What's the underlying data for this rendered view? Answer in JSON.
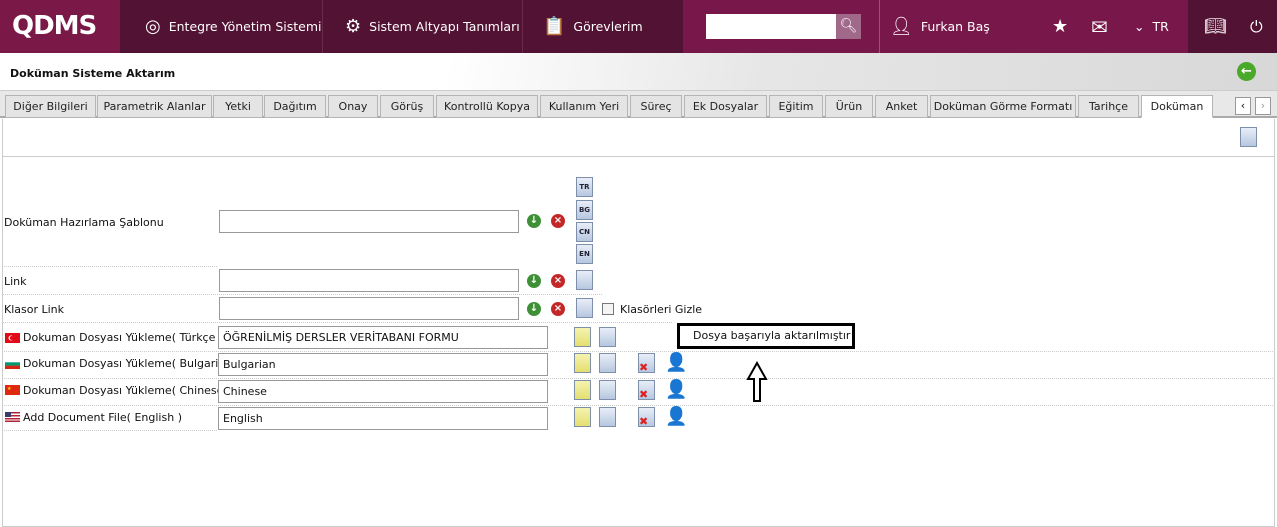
{
  "header": {
    "logo": "QDMS",
    "nav": [
      {
        "label": "Entegre Yönetim Sistemi",
        "icon": "q-circle-icon"
      },
      {
        "label": "Sistem Altyapı Tanımları",
        "icon": "gear-icon"
      },
      {
        "label": "Görevlerim",
        "icon": "clipboard-icon"
      }
    ],
    "search_placeholder": "",
    "user": "Furkan Baş",
    "lang": "TR"
  },
  "page": {
    "title": "Doküman Sisteme Aktarım"
  },
  "tabs": [
    "Diğer Bilgileri",
    "Parametrik Alanlar",
    "Yetki",
    "Dağıtım",
    "Onay",
    "Görüş",
    "Kontrollü Kopya",
    "Kullanım Yeri",
    "Süreç",
    "Ek Dosyalar",
    "Eğitim",
    "Ürün",
    "Anket",
    "Doküman Görme Formatı",
    "Tarihçe",
    "Doküman"
  ],
  "active_tab": "Doküman",
  "form": {
    "template_label": "Doküman Hazırlama Şablonu",
    "template_value": "",
    "lang_icons": [
      "TR",
      "BG",
      "CN",
      "EN"
    ],
    "link_label": "Link",
    "link_value": "",
    "folder_link_label": "Klasor Link",
    "folder_link_value": "",
    "hide_folders_label": "Klasörleri Gizle",
    "uploads": [
      {
        "label": "Dokuman Dosyası Yükleme( Türkçe )",
        "value": "ÖĞRENİLMİŞ DERSLER VERİTABANI FORMU",
        "flag": "tr"
      },
      {
        "label": "Dokuman Dosyası Yükleme( Bulgarian )",
        "value": "Bulgarian",
        "flag": "bg"
      },
      {
        "label": "Dokuman Dosyası Yükleme( Chinese )",
        "value": "Chinese",
        "flag": "cn"
      },
      {
        "label": "Add Document File( English )",
        "value": "English",
        "flag": "us"
      }
    ]
  },
  "message": "Dosya başarıyla aktarılmıştır"
}
